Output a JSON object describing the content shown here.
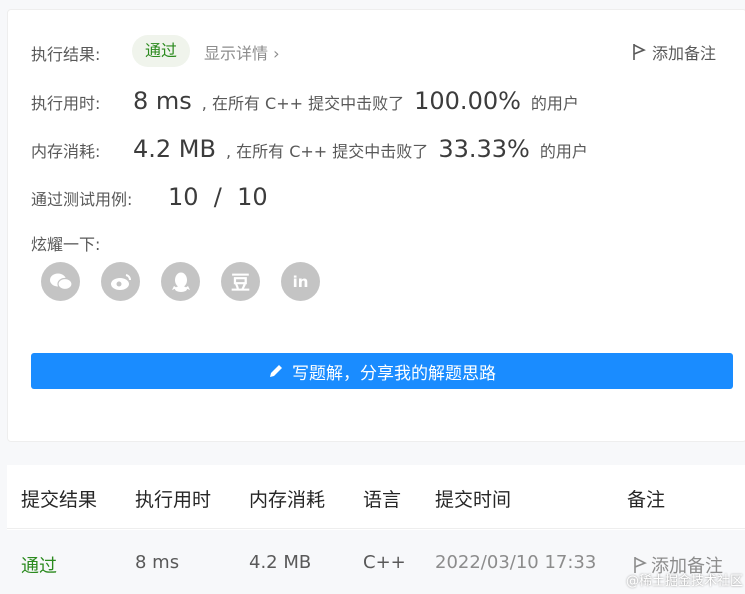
{
  "result": {
    "label": "执行结果:",
    "status": "通过",
    "details_link": "显示详情 ›",
    "add_note": "添加备注"
  },
  "runtime": {
    "label": "执行用时:",
    "value": "8 ms",
    "middle": ", 在所有 C++ 提交中击败了",
    "percent": "100.00%",
    "suffix": "的用户"
  },
  "memory": {
    "label": "内存消耗:",
    "value": "4.2 MB",
    "middle": ", 在所有 C++ 提交中击败了",
    "percent": "33.33%",
    "suffix": "的用户"
  },
  "tests": {
    "label": "通过测试用例:",
    "value": "10  /  10"
  },
  "share": {
    "label": "炫耀一下:",
    "icons": [
      "wechat-icon",
      "weibo-icon",
      "qq-icon",
      "douban-icon",
      "linkedin-icon"
    ],
    "douban_glyph": "豆",
    "linkedin_glyph": "in"
  },
  "cta": {
    "label": "写题解，分享我的解题思路"
  },
  "table": {
    "headers": [
      "提交结果",
      "执行用时",
      "内存消耗",
      "语言",
      "提交时间",
      "备注"
    ],
    "row": {
      "status": "通过",
      "runtime": "8 ms",
      "memory": "4.2 MB",
      "language": "C++",
      "time": "2022/03/10 17:33",
      "note": "添加备注"
    }
  },
  "watermark": "@稀土掘金技术社区",
  "colors": {
    "accent": "#1a8cff",
    "success": "#2b8a1e",
    "icon_gray": "#c4c4c4"
  }
}
